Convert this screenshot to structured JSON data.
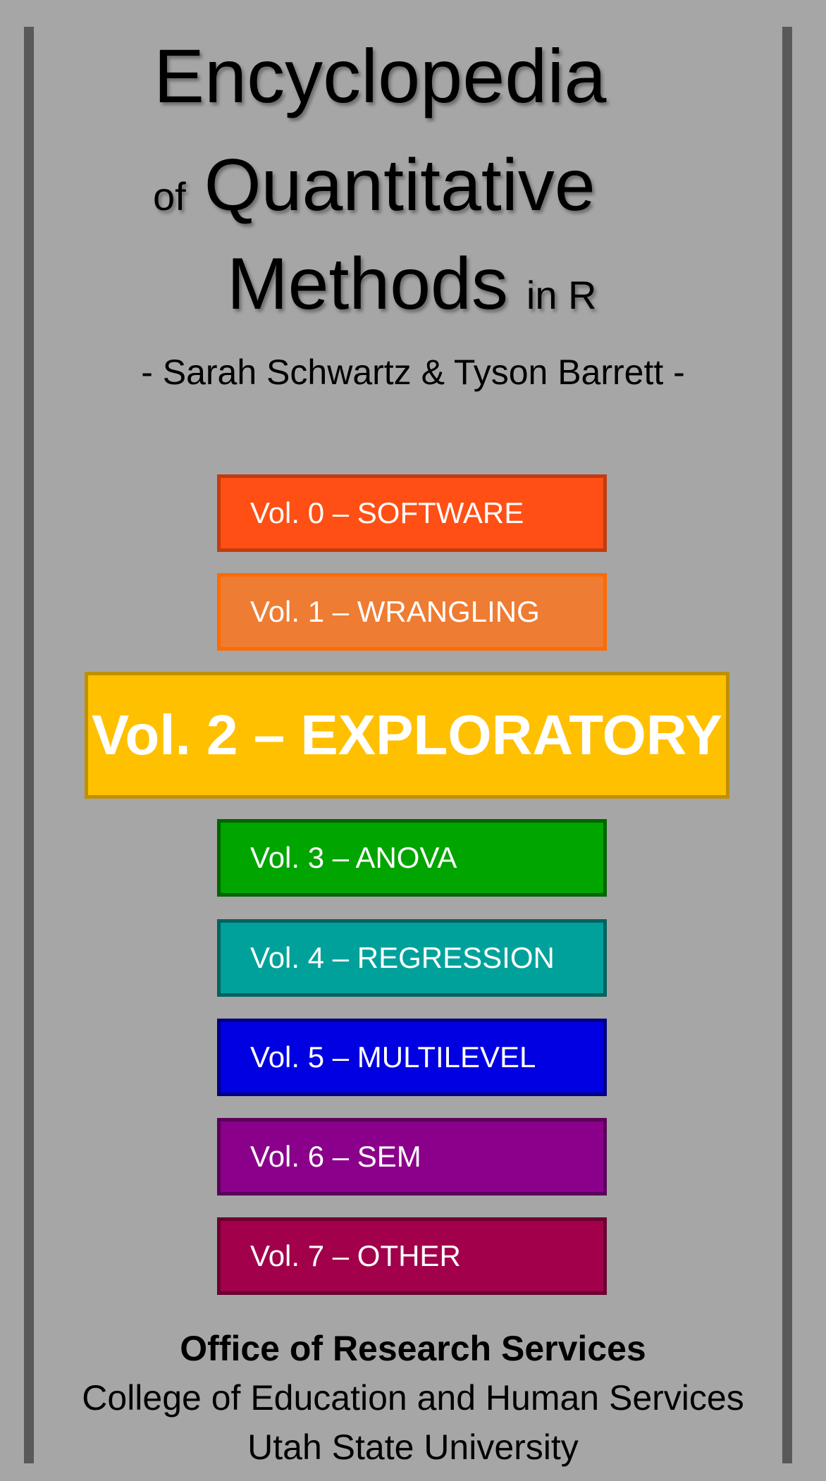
{
  "title": {
    "line1": "Encyclopedia",
    "of": "of",
    "line2": "Quantitative",
    "line3": "Methods",
    "in_r": "in R"
  },
  "authors": "- Sarah Schwartz & Tyson Barrett -",
  "volumes": [
    {
      "label": "Vol. 0 – SOFTWARE",
      "color": "#ff4f14",
      "border": "#c23b10"
    },
    {
      "label": "Vol. 1 – WRANGLING",
      "color": "#ee7c33",
      "border": "#ff6a00"
    },
    {
      "label": "Vol. 2 – EXPLORATORY",
      "color": "#ffc000",
      "border": "#bf9000",
      "featured": true
    },
    {
      "label": "Vol. 3 – ANOVA",
      "color": "#00a500",
      "border": "#006400"
    },
    {
      "label": "Vol. 4 – REGRESSION",
      "color": "#00a19b",
      "border": "#00625e"
    },
    {
      "label": "Vol. 5 – MULTILEVEL",
      "color": "#0000e0",
      "border": "#000080"
    },
    {
      "label": "Vol. 6 – SEM",
      "color": "#8b008b",
      "border": "#5a005a"
    },
    {
      "label": "Vol. 7 – OTHER",
      "color": "#a2004a",
      "border": "#6a0030"
    }
  ],
  "footer": {
    "office": "Office of Research Services",
    "college": "College of Education and Human Services",
    "university": "Utah State University"
  },
  "colors": {
    "background": "#a6a6a6",
    "side_bars": "#595959"
  }
}
